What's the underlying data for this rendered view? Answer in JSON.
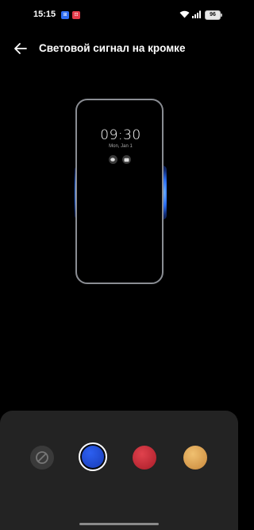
{
  "status_bar": {
    "time": "15:15",
    "notifications": [
      {
        "icon": "app-notification-icon",
        "text": "⊞",
        "color": "#2f6ef5"
      },
      {
        "icon": "app-notification-icon",
        "text": "⊡",
        "color": "#e33b4a"
      }
    ],
    "battery": "96"
  },
  "header": {
    "title": "Световой сигнал на кромке"
  },
  "preview": {
    "clock": "09:30",
    "date": "Mon, Jan 1",
    "glow_color": "#2a6df2"
  },
  "colors": [
    {
      "name": "none",
      "hex": null,
      "selected": false
    },
    {
      "name": "blue",
      "hex": "#2448d0",
      "selected": true
    },
    {
      "name": "red",
      "hex": "#c92a36",
      "selected": false
    },
    {
      "name": "gold",
      "hex": "#e0a858",
      "selected": false
    }
  ]
}
